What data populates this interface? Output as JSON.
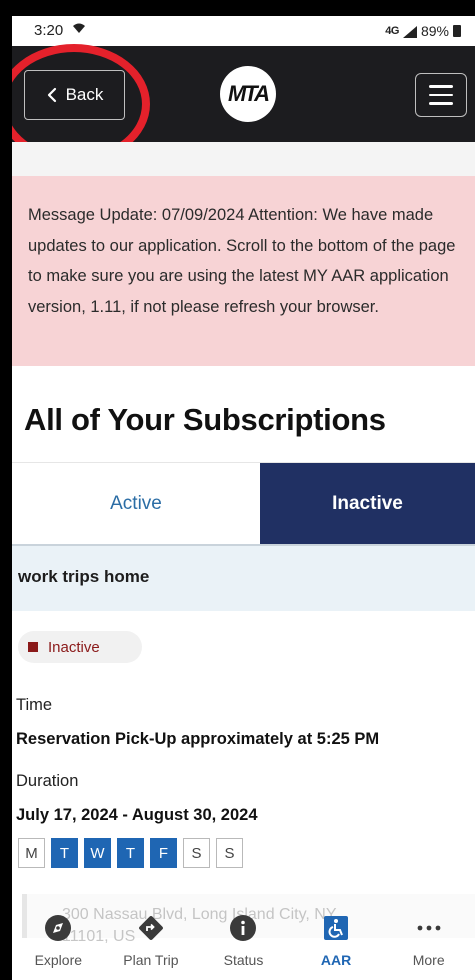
{
  "status_bar": {
    "time": "3:20",
    "network": "4G",
    "battery": "89%"
  },
  "header": {
    "back_label": "Back",
    "logo_text": "MTA"
  },
  "alert": {
    "message": "Message Update: 07/09/2024 Attention: We have made updates to our application. Scroll to the bottom of the page to make sure you are using the latest MY AAR application version, 1.11, if not please refresh your browser."
  },
  "page_title": "All of Your Subscriptions",
  "tabs": [
    {
      "label": "Active",
      "selected": false
    },
    {
      "label": "Inactive",
      "selected": true
    }
  ],
  "subscription": {
    "name": "work trips home",
    "status": "Inactive",
    "time_label": "Time",
    "time_value": "Reservation Pick-Up approximately at 5:25 PM",
    "duration_label": "Duration",
    "duration_value": "July 17, 2024 - August 30, 2024",
    "days": [
      {
        "label": "M",
        "on": false
      },
      {
        "label": "T",
        "on": true
      },
      {
        "label": "W",
        "on": true
      },
      {
        "label": "T",
        "on": true
      },
      {
        "label": "F",
        "on": true
      },
      {
        "label": "S",
        "on": false
      },
      {
        "label": "S",
        "on": false
      }
    ],
    "address_line1": "300 Nassau Blvd, Long Island City, NY",
    "address_line2": "11101, US"
  },
  "bottom_nav": [
    {
      "label": "Explore",
      "icon": "compass-icon"
    },
    {
      "label": "Plan Trip",
      "icon": "directions-icon"
    },
    {
      "label": "Status",
      "icon": "info-icon"
    },
    {
      "label": "AAR",
      "icon": "accessible-icon"
    },
    {
      "label": "More",
      "icon": "more-dots-icon"
    }
  ],
  "colors": {
    "header_bg": "#1c1c1f",
    "alert_bg": "#f7d3d5",
    "tab_selected_bg": "#203063",
    "accent_blue": "#1f66b3",
    "inactive_red": "#8b1a1a",
    "annotation_red": "#e4212b"
  }
}
